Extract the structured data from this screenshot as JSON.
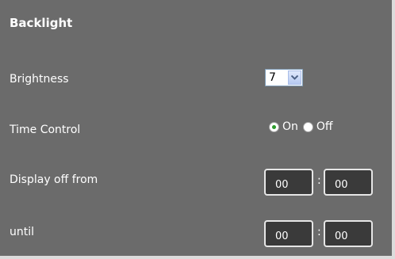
{
  "section": {
    "title": "Backlight"
  },
  "brightness": {
    "label": "Brightness",
    "value": "7",
    "arrow_icon": "chevron-down-icon"
  },
  "time_control": {
    "label": "Time Control",
    "options": [
      {
        "label": "On",
        "selected": true
      },
      {
        "label": "Off",
        "selected": false
      }
    ]
  },
  "display_off_from": {
    "label": "Display off from",
    "hour": "00",
    "minute": "00",
    "separator": ":"
  },
  "until": {
    "label": "until",
    "hour": "00",
    "minute": "00",
    "separator": ":"
  },
  "colors": {
    "background": "#6b6b6b",
    "field_background": "#3a3a3a",
    "radio_selected": "#2b9a2b"
  }
}
